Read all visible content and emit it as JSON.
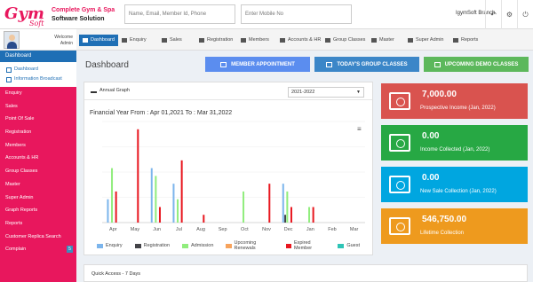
{
  "brand": {
    "line1": "Complete Gym & Spa",
    "line2": "Software Solution",
    "logo_text": "Gym Soft"
  },
  "header": {
    "search_placeholder": "Name, Email, Member Id, Phone",
    "mobile_placeholder": "Enter Mobile No",
    "branch": "IgymSoft Branch",
    "icons": [
      "back-arrow-icon",
      "gear-icon",
      "power-icon"
    ]
  },
  "user": {
    "welcome": "Welcome",
    "role": "Admin"
  },
  "sidebar": {
    "dashboard": "Dashboard",
    "sub_items": [
      {
        "label": "Dashboard"
      },
      {
        "label": "Information Broadcast"
      }
    ],
    "items": [
      {
        "label": "Enquiry"
      },
      {
        "label": "Sales"
      },
      {
        "label": "Point Of Sale"
      },
      {
        "label": "Registration"
      },
      {
        "label": "Members"
      },
      {
        "label": "Accounts & HR"
      },
      {
        "label": "Group Classes"
      },
      {
        "label": "Master"
      },
      {
        "label": "Super Admin"
      },
      {
        "label": "Graph Reports"
      },
      {
        "label": "Reports"
      },
      {
        "label": "Customer Replica Search"
      },
      {
        "label": "Complain",
        "badge": "5"
      }
    ]
  },
  "tabs": [
    "Dashboard",
    "Enquiry",
    "Sales",
    "Registration",
    "Members",
    "Accounts & HR",
    "Group Classes",
    "Master",
    "Super Admin",
    "Reports"
  ],
  "page": {
    "title": "Dashboard",
    "buttons": [
      {
        "label": "MEMBER APPOINTMENT",
        "color": "#5b8def"
      },
      {
        "label": "TODAY'S GROUP CLASSES",
        "color": "#3b86c8"
      },
      {
        "label": "UPCOMING DEMO CLASSES",
        "color": "#5cb85c"
      }
    ]
  },
  "graph": {
    "panel_title": "Annual Graph",
    "year": "2021-2022",
    "subtitle": "Financial Year From : Apr 01,2021 To : Mar 31,2022"
  },
  "chart_data": {
    "type": "bar",
    "categories": [
      "Apr",
      "May",
      "Jun",
      "Jul",
      "Aug",
      "Sep",
      "Oct",
      "Nov",
      "Dec",
      "Jan",
      "Feb",
      "Mar"
    ],
    "series": [
      {
        "name": "Enquiry",
        "color": "#7cb5ec",
        "values": [
          3,
          0,
          7,
          5,
          0,
          0,
          0,
          0,
          5,
          0,
          0,
          0
        ]
      },
      {
        "name": "Registration",
        "color": "#434348",
        "values": [
          0,
          0,
          0,
          0,
          0,
          0,
          0,
          0,
          1,
          0,
          0,
          0
        ]
      },
      {
        "name": "Admission",
        "color": "#90ed7d",
        "values": [
          7,
          0,
          6,
          3,
          0,
          0,
          4,
          0,
          4,
          2,
          0,
          0
        ]
      },
      {
        "name": "Upcoming Renewals",
        "color": "#f7a35c",
        "values": [
          0,
          0,
          0,
          0,
          0,
          0,
          0,
          0,
          0,
          0,
          0,
          0
        ]
      },
      {
        "name": "Expired Member",
        "color": "#e8171f",
        "values": [
          4,
          12,
          2,
          8,
          1,
          0,
          0,
          5,
          2,
          2,
          0,
          0
        ]
      },
      {
        "name": "Guest",
        "color": "#2ec4b6",
        "values": [
          0,
          0,
          0,
          0,
          0,
          0,
          0,
          0,
          0,
          0,
          0,
          0
        ]
      }
    ],
    "ylim": [
      0,
      13
    ]
  },
  "stats": [
    {
      "value": "7,000.00",
      "label": "Prospective Income (Jan, 2022)",
      "color": "#d9534f",
      "icon": "money-icon"
    },
    {
      "value": "0.00",
      "label": "Income Collected (Jan, 2022)",
      "color": "#27a844",
      "icon": "receipt-icon"
    },
    {
      "value": "0.00",
      "label": "New Sale Collection (Jan, 2022)",
      "color": "#00a6e0",
      "icon": "calculator-icon"
    },
    {
      "value": "546,750.00",
      "label": "Lifetime Collection",
      "color": "#ee9a1e",
      "icon": "cash-hand-icon"
    }
  ],
  "quick_access": "Quick Access - 7 Days"
}
